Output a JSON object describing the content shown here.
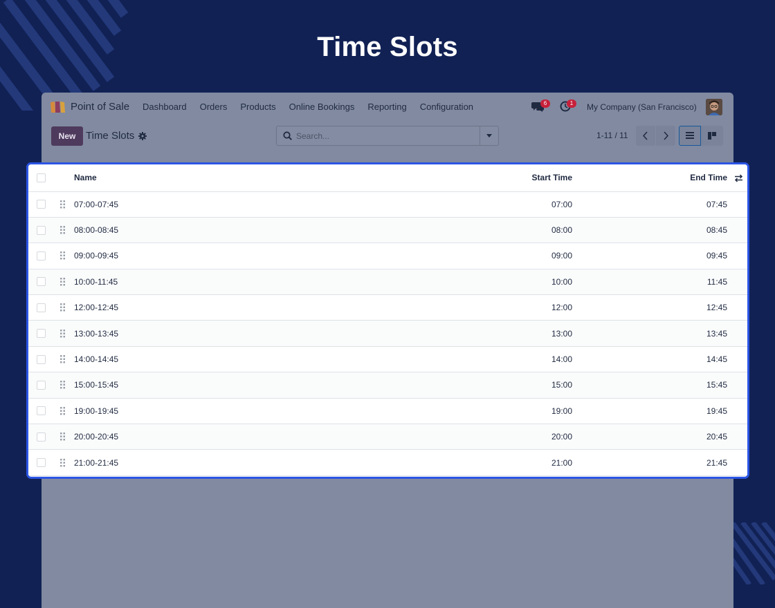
{
  "page": {
    "title": "Time Slots",
    "background": "#112154",
    "highlight": "#2b55e5"
  },
  "navbar": {
    "app_name": "Point of Sale",
    "menu": [
      "Dashboard",
      "Orders",
      "Products",
      "Online Bookings",
      "Reporting",
      "Configuration"
    ],
    "chat_badge": "6",
    "activity_badge": "1",
    "company": "My Company (San Francisco)"
  },
  "control": {
    "new_label": "New",
    "breadcrumb": "Time Slots",
    "search_placeholder": "Search...",
    "pager": "1-11 / 11"
  },
  "table": {
    "columns": {
      "name": "Name",
      "start": "Start Time",
      "end": "End Time"
    },
    "rows": [
      {
        "name": "07:00-07:45",
        "start": "07:00",
        "end": "07:45"
      },
      {
        "name": "08:00-08:45",
        "start": "08:00",
        "end": "08:45"
      },
      {
        "name": "09:00-09:45",
        "start": "09:00",
        "end": "09:45"
      },
      {
        "name": "10:00-11:45",
        "start": "10:00",
        "end": "11:45"
      },
      {
        "name": "12:00-12:45",
        "start": "12:00",
        "end": "12:45"
      },
      {
        "name": "13:00-13:45",
        "start": "13:00",
        "end": "13:45"
      },
      {
        "name": "14:00-14:45",
        "start": "14:00",
        "end": "14:45"
      },
      {
        "name": "15:00-15:45",
        "start": "15:00",
        "end": "15:45"
      },
      {
        "name": "19:00-19:45",
        "start": "19:00",
        "end": "19:45"
      },
      {
        "name": "20:00-20:45",
        "start": "20:00",
        "end": "20:45"
      },
      {
        "name": "21:00-21:45",
        "start": "21:00",
        "end": "21:45"
      }
    ]
  }
}
